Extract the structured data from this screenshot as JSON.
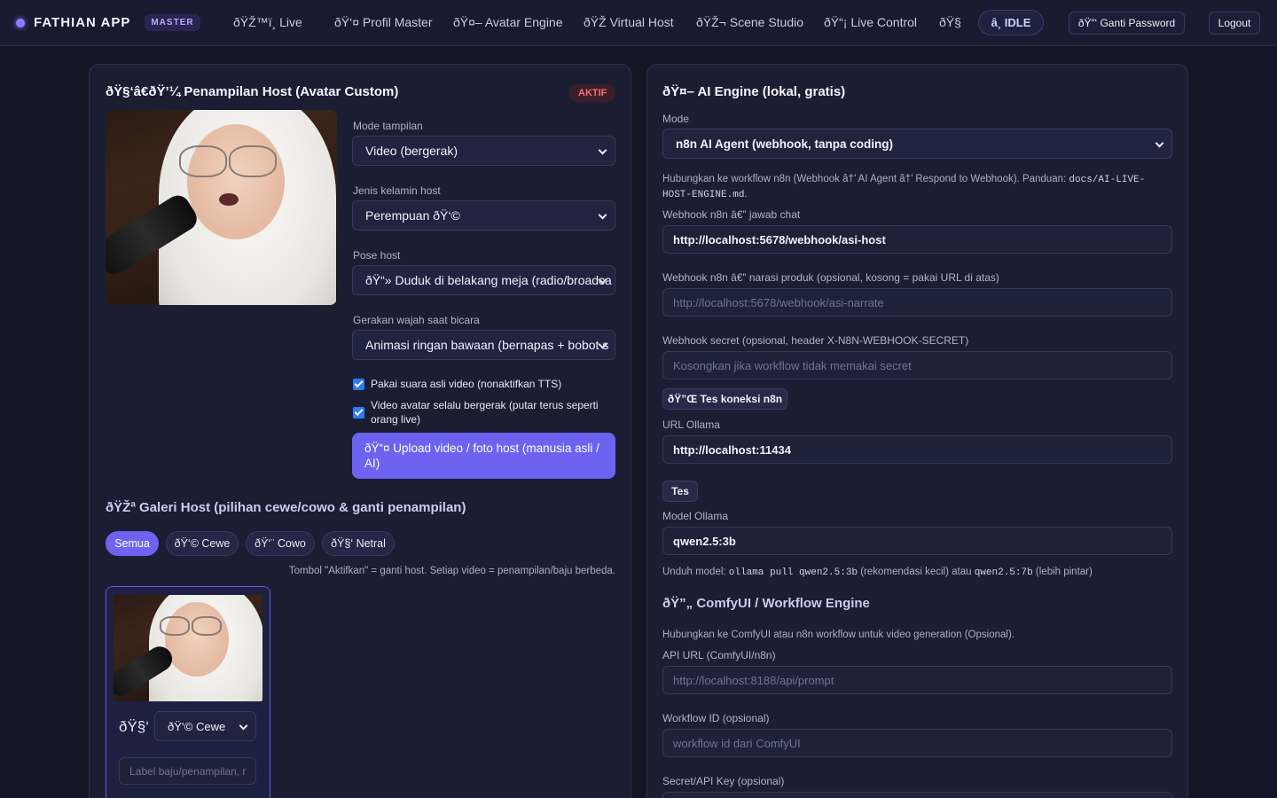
{
  "brand": {
    "name": "FATHIAN APP",
    "badge": "MASTER"
  },
  "nav": {
    "items": [
      {
        "label": "ðŸŽ™ï¸ Live"
      },
      {
        "label": "ðŸ‘¤ Profil Master"
      },
      {
        "label": "ðŸ¤– Avatar Engine"
      },
      {
        "label": "ðŸŽ Virtual Host"
      },
      {
        "label": "ðŸŽ¬ Scene Studio"
      },
      {
        "label": "ðŸ“¡ Live Control"
      },
      {
        "label": "ðŸ§"
      }
    ],
    "status": "â¸ IDLE",
    "change_password": "ðŸ”‘ Ganti Password",
    "logout": "Logout"
  },
  "left": {
    "title": "ðŸ§‘â€ðŸ’¼ Penampilan Host (Avatar Custom)",
    "badge": "AKTIF",
    "mode_label": "Mode tampilan",
    "mode_value": "Video (bergerak)",
    "gender_label": "Jenis kelamin host",
    "gender_value": "Perempuan ðŸ‘©",
    "pose_label": "Pose host",
    "pose_value": "ðŸ“» Duduk di belakang meja (radio/broadca",
    "face_label": "Gerakan wajah saat bicara",
    "face_value": "Animasi ringan bawaan (bernapas + bobot s",
    "check1": "Pakai suara asli video (nonaktifkan TTS)",
    "check2": "Video avatar selalu bergerak (putar terus seperti orang live)",
    "upload_button": "ðŸ“¤ Upload video / foto host (manusia asli / AI)",
    "gallery_title": "ðŸŽª Galeri Host (pilihan cewe/cowo & ganti penampilan)",
    "filters": [
      "Semua",
      "ðŸ‘© Cewe",
      "ðŸ‘¨ Cowo",
      "ðŸ§‘ Netral"
    ],
    "gallery_hint": "Tombol \"Aktifkan\" = ganti host. Setiap video = penampilan/baju berbeda.",
    "card": {
      "icon_glyph": "ðŸ§‘",
      "gender_value": "ðŸ‘© Cewe",
      "label_placeholder": "Label baju/penampilan, n"
    }
  },
  "right": {
    "title": "ðŸ¤– AI Engine (lokal, gratis)",
    "mode_label": "Mode",
    "mode_value": "n8n AI Agent (webhook, tanpa coding)",
    "hint_text": "Hubungkan ke workflow n8n (Webhook â†’ AI Agent â†’ Respond to Webhook). Panduan: ",
    "hint_code": "docs/AI-LIVE-HOST-ENGINE.md",
    "hint_end": ".",
    "webhook_chat_label": "Webhook n8n â€” jawab chat",
    "webhook_chat_value": "http://localhost:5678/webhook/asi-host",
    "webhook_narrate_label": "Webhook n8n â€” narasi produk (opsional, kosong = pakai URL di atas)",
    "webhook_narrate_placeholder": "http://localhost:5678/webhook/asi-narrate",
    "secret_label": "Webhook secret (opsional, header X-N8N-WEBHOOK-SECRET)",
    "secret_placeholder": "Kosongkan jika workflow tidak memakai secret",
    "test_n8n_button": "ðŸ”Œ Tes koneksi n8n",
    "ollama_url_label": "URL Ollama",
    "ollama_url_value": "http://localhost:11434",
    "test_button": "Tes",
    "ollama_model_label": "Model Ollama",
    "ollama_model_value": "qwen2.5:3b",
    "model_hint_a": "Unduh model: ",
    "model_hint_code1": "ollama pull qwen2.5:3b",
    "model_hint_b": " (rekomendasi kecil) atau ",
    "model_hint_code2": "qwen2.5:7b",
    "model_hint_c": " (lebih pintar)",
    "comfy_title": "ðŸ”„ ComfyUI / Workflow Engine",
    "comfy_hint": "Hubungkan ke ComfyUI atau n8n workflow untuk video generation (Opsional).",
    "api_url_label": "API URL (ComfyUI/n8n)",
    "api_url_placeholder": "http://localhost:8188/api/prompt",
    "workflow_label": "Workflow ID (opsional)",
    "workflow_placeholder": "workflow id dari ComfyUI",
    "secret_api_label": "Secret/API Key (opsional)"
  },
  "colors": {
    "accent": "#6d63f0",
    "background": "#141628",
    "panel": "#1b1e33",
    "danger": "#ff6b6b"
  }
}
